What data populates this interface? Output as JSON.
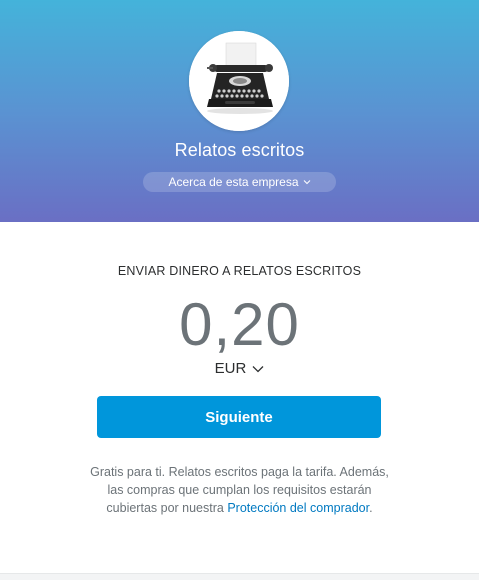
{
  "header": {
    "company_name": "Relatos escritos",
    "about_label": "Acerca de esta empresa",
    "avatar_icon": "typewriter-icon"
  },
  "payment": {
    "title": "ENVIAR DINERO A RELATOS ESCRITOS",
    "amount": "0,20",
    "currency": "EUR",
    "next_label": "Siguiente"
  },
  "notice": {
    "text": "Gratis para ti. Relatos escritos paga la tarifa. Además, las compras que cumplan los requisitos estarán cubiertas por nuestra ",
    "link_label": "Protección del comprador",
    "end": "."
  },
  "colors": {
    "header_top": "#44b3da",
    "header_bottom": "#6a6fc4",
    "button": "#0096db",
    "link": "#0079c1"
  }
}
